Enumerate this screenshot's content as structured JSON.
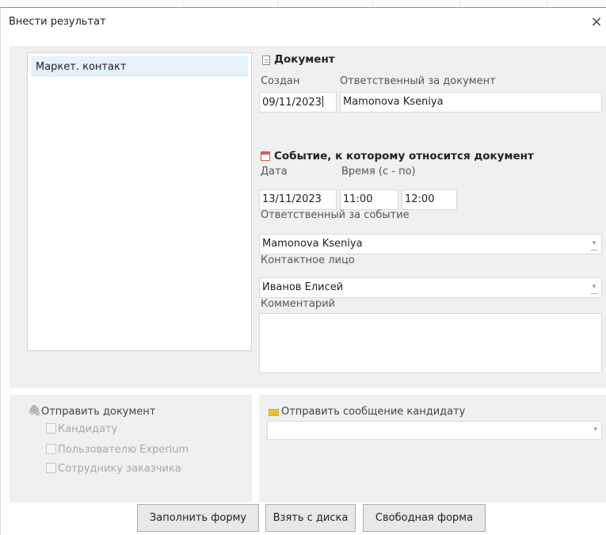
{
  "dialog": {
    "title": "Внести результат",
    "close_glyph": "×"
  },
  "left_list": {
    "items": [
      "Маркет. контакт"
    ]
  },
  "document": {
    "section_title": "Документ",
    "icon": "document-icon",
    "created_label": "Создан",
    "responsible_label": "Ответственный за документ",
    "created_value": "09/11/2023",
    "responsible_value": "Mamonova Kseniya"
  },
  "event": {
    "section_title": "Событие, к которому относится документ",
    "icon": "calendar-icon",
    "date_label": "Дата",
    "time_label": "Время (с - по)",
    "date_value": "13/11/2023",
    "time_from": "11:00",
    "time_to": "12:00",
    "responsible_label": "Ответственный за событие",
    "responsible_value": "Mamonova Kseniya",
    "contact_label": "Контактное лицо",
    "contact_value": "Иванов Елисей",
    "comment_label": "Комментарий",
    "comment_value": ""
  },
  "send_document": {
    "label": "Отправить документ",
    "icon": "paperclip-icon",
    "options": [
      "Кандидату",
      "Пользователю Experium",
      "Сотруднику заказчика"
    ]
  },
  "send_message": {
    "label": "Отправить сообщение кандидату",
    "icon": "envelope-icon",
    "value": ""
  },
  "buttons": {
    "fill_form": "Заполнить форму",
    "from_disk": "Взять с диска",
    "free_form": "Свободная форма"
  },
  "colors": {
    "panel_bg": "#f0f0f0",
    "selection": "#e5f1fb",
    "title_border": "#6a96cf",
    "calendar_accent": "#e05a55",
    "envelope_accent": "#f2c53d"
  }
}
